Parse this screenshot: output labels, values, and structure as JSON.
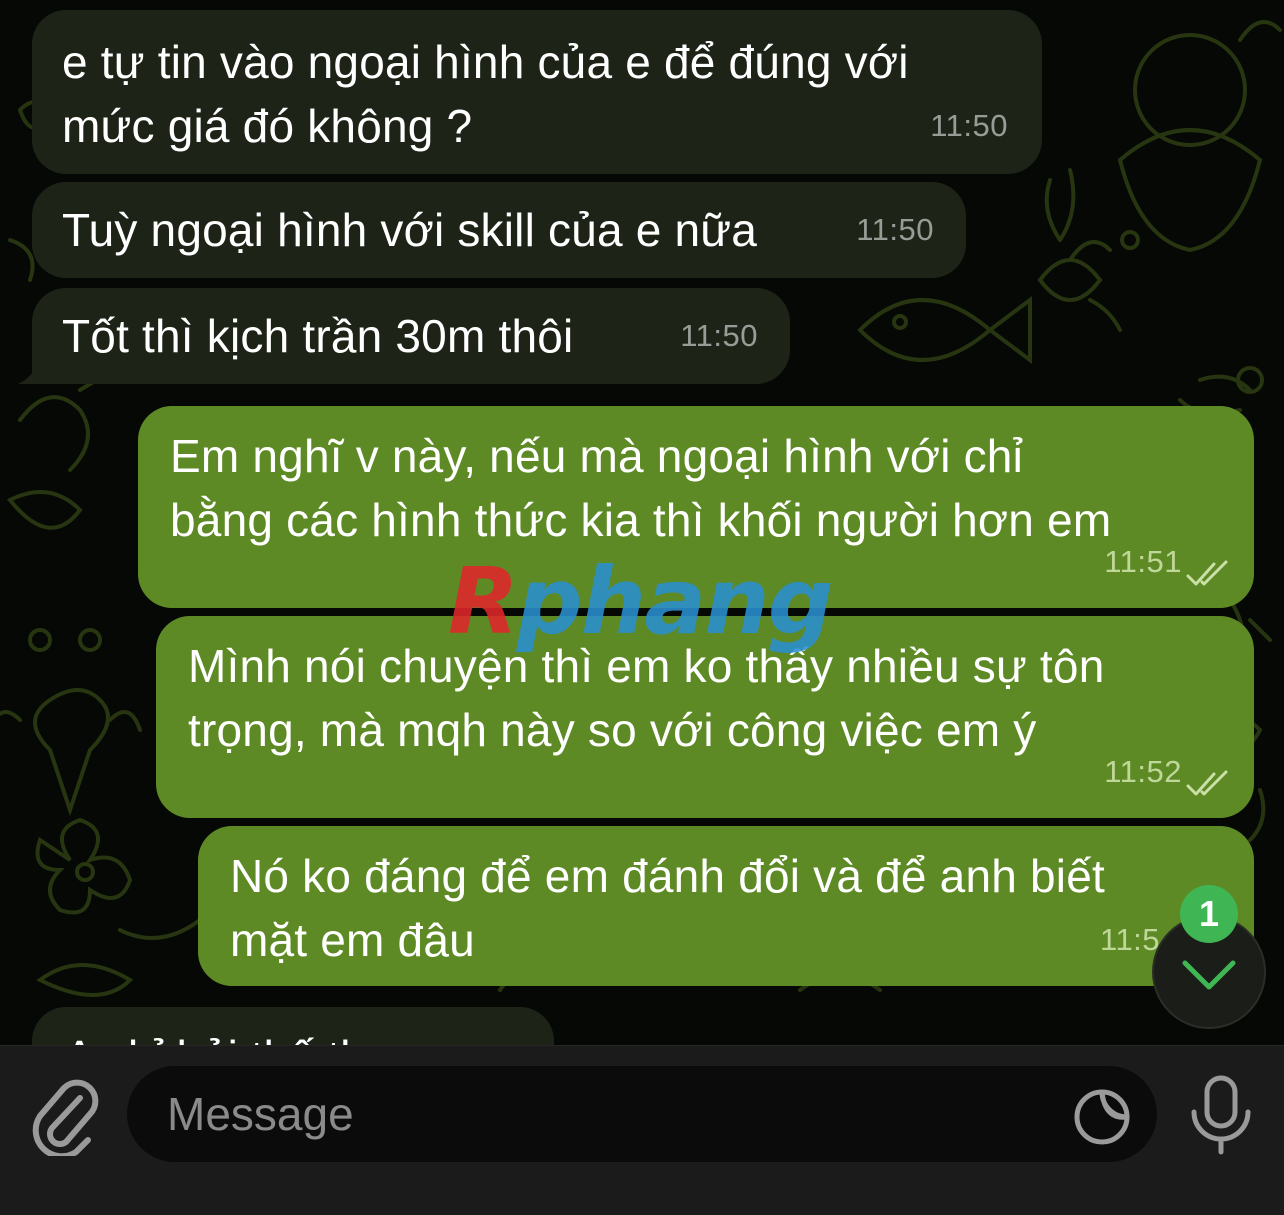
{
  "messages": [
    {
      "direction": "incoming",
      "lines": [
        "e tự tin vào ngoại hình của e để đúng với",
        "mức giá đó không ?"
      ],
      "time": "11:50"
    },
    {
      "direction": "incoming",
      "lines": [
        "Tuỳ ngoại hình với skill của e nữa"
      ],
      "time": "11:50"
    },
    {
      "direction": "incoming",
      "lines": [
        "Tốt thì kịch trần 30m thôi"
      ],
      "time": "11:50"
    },
    {
      "direction": "outgoing",
      "lines": [
        "Em nghĩ v này, nếu mà ngoại hình với chỉ",
        "bằng các hình thức kia thì khối người hơn em"
      ],
      "time": "11:51",
      "status": "read"
    },
    {
      "direction": "outgoing",
      "lines": [
        "Mình nói chuyện thì em ko thấy nhiều sự tôn",
        "trọng, mà mqh này so với công việc em ý"
      ],
      "time": "11:52",
      "status": "read"
    },
    {
      "direction": "outgoing",
      "lines": [
        "Nó ko đáng để em đánh đổi và để anh biết",
        "mặt em đâu"
      ],
      "time": "11:5"
    }
  ],
  "partial_message": "A chỉ hỏi thế th",
  "watermark": {
    "first": "R",
    "rest": "phang"
  },
  "scroll_button": {
    "unread_count": "1"
  },
  "input": {
    "placeholder": "Message",
    "value": ""
  },
  "icons": {
    "attach": "paperclip-icon",
    "sticker": "sticker-icon",
    "voice": "microphone-icon",
    "scroll": "chevron-down-icon"
  },
  "colors": {
    "incoming_bubble": "#1d2317",
    "outgoing_bubble": "#5d8a24",
    "badge": "#3fb553",
    "background": "#050805"
  }
}
